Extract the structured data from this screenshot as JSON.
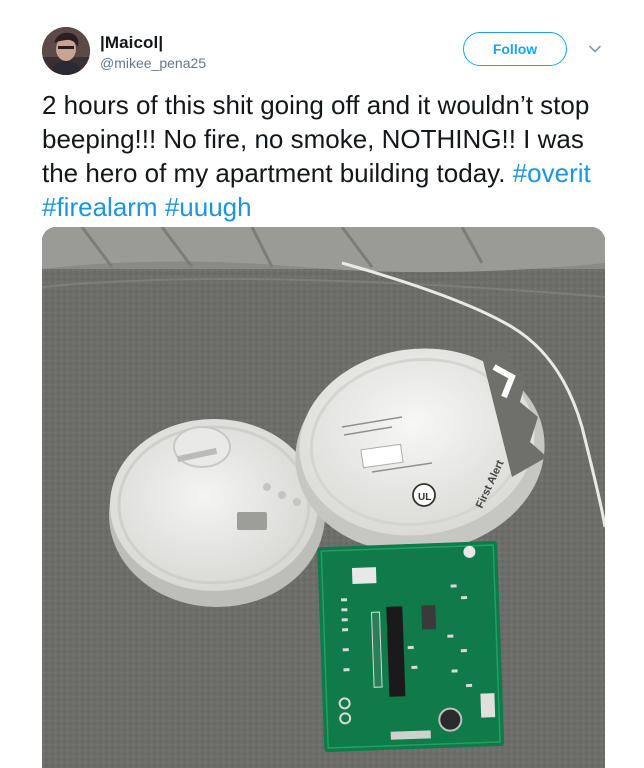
{
  "user": {
    "display_name": "|Maicol|",
    "handle": "@mikee_pena25",
    "avatar_icon": "user-avatar-photo"
  },
  "actions": {
    "follow_label": "Follow",
    "more_icon": "chevron-down-icon"
  },
  "tweet": {
    "text_segments": [
      "2 hours of this shit going off and it wouldn’t stop beeping!!! No fire, no smoke, NOTHING!! I was the hero of my apartment building today. ",
      "#overit",
      " ",
      "#firealarm",
      " ",
      "#uuugh"
    ],
    "hashtags": [
      "#overit",
      "#firealarm",
      "#uuugh"
    ]
  },
  "media": {
    "description_icon": "photo-of-dismantled-smoke-detector",
    "printed_labels": {
      "brand": "First Alert",
      "logo": "UL"
    }
  },
  "colors": {
    "link": "#1b95e0",
    "follow_accent": "#1da1f2",
    "text": "#14171a",
    "secondary_text": "#657786"
  }
}
